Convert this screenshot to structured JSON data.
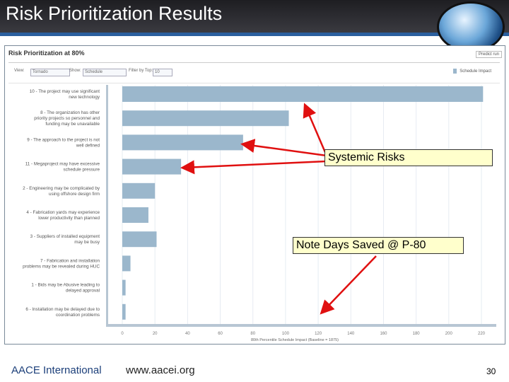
{
  "slide_title": "Risk Prioritization Results",
  "panel": {
    "title": "Risk Prioritization at 80%",
    "predict_button": "Predict run",
    "view_label": "View:",
    "view_value": "Tornado",
    "show_label": "Show:",
    "show_value": "Schedule",
    "filter_label": "Filter by Top:",
    "filter_value": "10"
  },
  "annotations": {
    "systemic": "Systemic Risks",
    "note": "Note Days Saved @ P-80"
  },
  "footer": {
    "logo": "AACE International",
    "url": "www.aacei.org",
    "page": "30"
  },
  "chart_data": {
    "type": "bar",
    "orientation": "horizontal",
    "categories": [
      "10 - The project may use significant new technology",
      "8 - The organization has other priority projects so personnel and funding may be unavailable",
      "9 - The approach to the project is not well defined",
      "11 - Megaproject may have excessive schedule pressure",
      "2 - Engineering may be complicated by using offshore design firm",
      "4 - Fabrication yards may experience lower productivity than planned",
      "3 - Suppliers of installed equipment may be busy",
      "7 - Fabrication and installation problems may be revealed during HUC",
      "1 - Bids may be Abusive leading to delayed approval",
      "6 - Installation may be delayed due to coordination problems"
    ],
    "series": [
      {
        "name": "Schedule Impact",
        "values": [
          221,
          102,
          74,
          36,
          20,
          16,
          21,
          5,
          2,
          2
        ]
      }
    ],
    "xlabel": "80th Percentile Schedule Impact (Baseline = 1875)",
    "xlim": [
      0,
      220
    ],
    "xticks": [
      0,
      20,
      40,
      60,
      80,
      100,
      120,
      140,
      160,
      180,
      200,
      220
    ],
    "legend": "top-right",
    "grid": true,
    "color": "#9bb7cc"
  }
}
